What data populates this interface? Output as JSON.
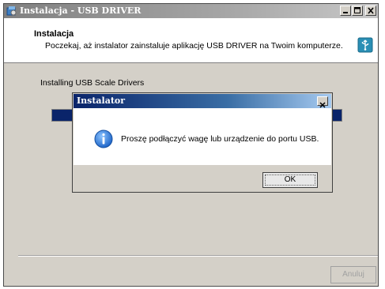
{
  "window": {
    "title": "Instalacja - USB DRIVER",
    "header_title": "Instalacja",
    "header_subtitle": "Poczekaj, aż instalator zainstaluje aplikację USB DRIVER na Twoim komputerze.",
    "status_text": "Installing USB Scale Drivers",
    "progress_fraction": 1.0,
    "cancel_label": "Anuluj"
  },
  "dialog": {
    "title": "Instalator",
    "message": "Proszę podłączyć wagę lub urządzenie do portu USB.",
    "ok_label": "OK"
  },
  "icons": {
    "app": "installer-icon",
    "usb": "usb-icon",
    "info": "info-icon",
    "close": "close-icon",
    "minimize": "minimize-icon",
    "maximize": "maximize-icon"
  },
  "colors": {
    "title_bar_inactive": "#808080",
    "title_bar_active": "#0a246a",
    "progress_fill": "#0a246a",
    "info_icon": "#1f66c9"
  }
}
